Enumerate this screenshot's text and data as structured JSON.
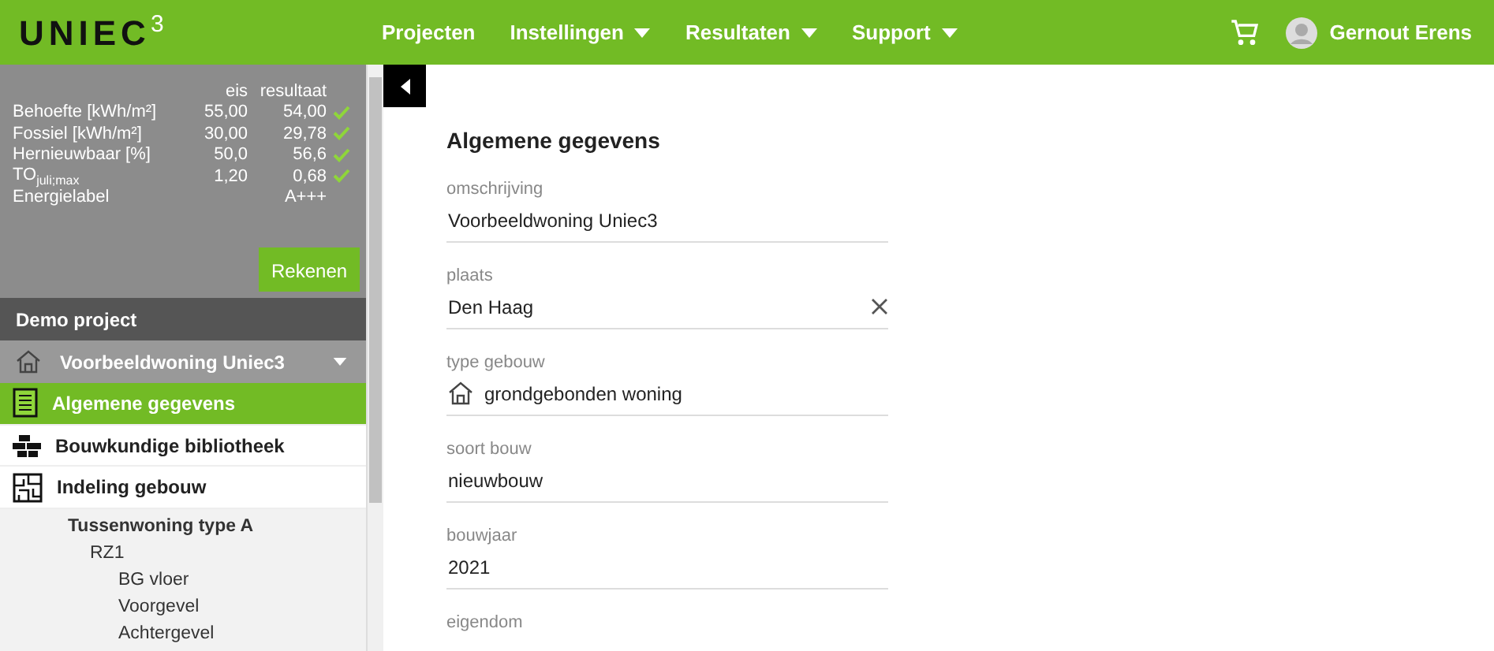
{
  "header": {
    "logo": "UNIEC$^{3}$",
    "menu": [
      {
        "label": "Projecten",
        "dropdown": false
      },
      {
        "label": "Instellingen",
        "dropdown": true
      },
      {
        "label": "Resultaten",
        "dropdown": true
      },
      {
        "label": "Support",
        "dropdown": true
      }
    ],
    "user": "Gernout Erens"
  },
  "results": {
    "columns": [
      "eis",
      "resultaat"
    ],
    "rows": [
      {
        "label": "Behoefte [kWh/m²]",
        "eis": "55,00",
        "resultaat": "54,00",
        "passed": true
      },
      {
        "label": "Fossiel [kWh/m²]",
        "eis": "30,00",
        "resultaat": "29,78",
        "passed": true
      },
      {
        "label": "Hernieuwbaar [%]",
        "eis": "50,0",
        "resultaat": "56,6",
        "passed": true
      },
      {
        "label": "TO$_{juli;max}$",
        "eis": "1,20",
        "resultaat": "0,68",
        "passed": true
      },
      {
        "label": "Energielabel",
        "eis": "",
        "resultaat": "A+++",
        "passed": false
      }
    ],
    "button": "Rekenen"
  },
  "project": {
    "title": "Demo project",
    "building": "Voorbeeldwoning Uniec3"
  },
  "nav": [
    {
      "label": "Algemene gegevens",
      "kind": "form",
      "selected": true
    },
    {
      "label": "Bouwkundige bibliotheek",
      "kind": "bricks",
      "selected": false
    },
    {
      "label": "Indeling gebouw",
      "kind": "floorplan",
      "selected": false
    }
  ],
  "tree": [
    {
      "label": "Tussenwoning type A",
      "children": [
        {
          "label": "RZ1",
          "children": [
            {
              "label": "BG vloer"
            },
            {
              "label": "Voorgevel"
            },
            {
              "label": "Achtergevel"
            }
          ]
        }
      ]
    }
  ],
  "form": {
    "title": "Algemene gegevens",
    "fields": [
      {
        "label": "omschrijving",
        "value": "Voorbeeldwoning Uniec3",
        "kind": "text"
      },
      {
        "label": "plaats",
        "value": "Den Haag",
        "kind": "clearable"
      },
      {
        "label": "type gebouw",
        "value": "grondgebonden woning",
        "kind": "icon"
      },
      {
        "label": "soort bouw",
        "value": "nieuwbouw",
        "kind": "text"
      },
      {
        "label": "bouwjaar",
        "value": "2021",
        "kind": "text"
      },
      {
        "label": "eigendom",
        "kind": "text"
      }
    ]
  }
}
